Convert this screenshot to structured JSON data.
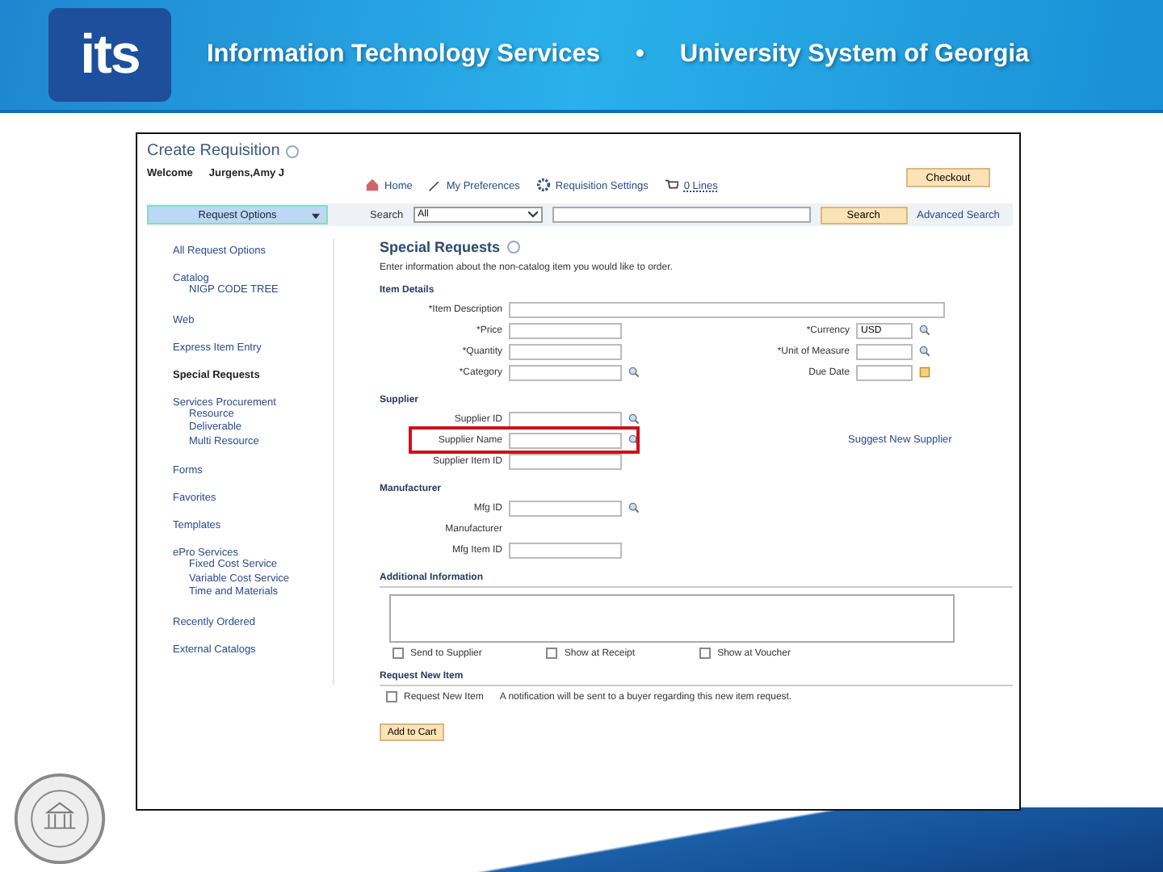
{
  "header": {
    "logo": "its",
    "title": "Information Technology Services",
    "separator": "•",
    "subtitle": "University System of Georgia"
  },
  "app": {
    "title": "Create Requisition",
    "welcome_label": "Welcome",
    "user": "Jurgens,Amy J",
    "nav": [
      {
        "kind": "home",
        "label": "Home"
      },
      {
        "kind": "prefs",
        "label": "My Preferences"
      },
      {
        "kind": "settings",
        "label": "Requisition Settings"
      },
      {
        "kind": "cart",
        "label": "0 Lines"
      }
    ],
    "checkout": "Checkout",
    "toolbar": {
      "request_options": "Request Options",
      "search_label": "Search",
      "search_scope": "All",
      "search_button": "Search",
      "advanced_search": "Advanced Search"
    },
    "sidebar": [
      {
        "label": "All Request Options",
        "selected": false
      },
      {
        "label": "Catalog",
        "selected": false,
        "children": [
          "NIGP CODE TREE"
        ]
      },
      {
        "label": "Web",
        "selected": false
      },
      {
        "label": "Express Item Entry",
        "selected": false
      },
      {
        "label": "Special Requests",
        "selected": true
      },
      {
        "label": "Services Procurement",
        "selected": false,
        "children": [
          "Resource",
          "Deliverable",
          "Multi Resource"
        ]
      },
      {
        "label": "Forms",
        "selected": false
      },
      {
        "label": "Favorites",
        "selected": false
      },
      {
        "label": "Templates",
        "selected": false
      },
      {
        "label": "ePro Services",
        "selected": false,
        "children": [
          "Fixed Cost Service",
          "Variable Cost Service",
          "Time and Materials"
        ]
      },
      {
        "label": "Recently Ordered",
        "selected": false
      },
      {
        "label": "External Catalogs",
        "selected": false
      }
    ],
    "main": {
      "title": "Special Requests",
      "intro": "Enter information about the non-catalog item you would like to order.",
      "item_details": {
        "heading": "Item Details",
        "description": {
          "label": "*Item Description"
        },
        "left": [
          {
            "label": "*Price",
            "kind": "text"
          },
          {
            "label": "*Quantity",
            "kind": "text"
          },
          {
            "label": "*Category",
            "kind": "lookup"
          }
        ],
        "right": [
          {
            "label": "*Currency",
            "kind": "lookup",
            "value": "USD"
          },
          {
            "label": "*Unit of Measure",
            "kind": "lookup"
          },
          {
            "label": "Due Date",
            "kind": "date"
          }
        ]
      },
      "supplier": {
        "heading": "Supplier",
        "link": "Suggest New Supplier",
        "fields": [
          {
            "label": "Supplier ID",
            "kind": "lookup",
            "highlighted": false
          },
          {
            "label": "Supplier Name",
            "kind": "lookup",
            "highlighted": true
          },
          {
            "label": "Supplier Item ID",
            "kind": "text",
            "highlighted": false
          }
        ]
      },
      "manufacturer": {
        "heading": "Manufacturer",
        "fields": [
          {
            "label": "Mfg ID",
            "kind": "lookup"
          },
          {
            "label": "Manufacturer",
            "kind": "none"
          },
          {
            "label": "Mfg Item ID",
            "kind": "text"
          }
        ]
      },
      "additional": {
        "heading": "Additional Information",
        "checks": [
          {
            "label": "Send to Supplier",
            "checked": false
          },
          {
            "label": "Show at Receipt",
            "checked": false
          },
          {
            "label": "Show at Voucher",
            "checked": false
          }
        ]
      },
      "request_new": {
        "heading": "Request New Item",
        "check": {
          "label": "Request New Item",
          "checked": false
        },
        "note": "A notification will be sent to a buyer regarding this new item request."
      },
      "add_button": "Add to Cart"
    }
  }
}
